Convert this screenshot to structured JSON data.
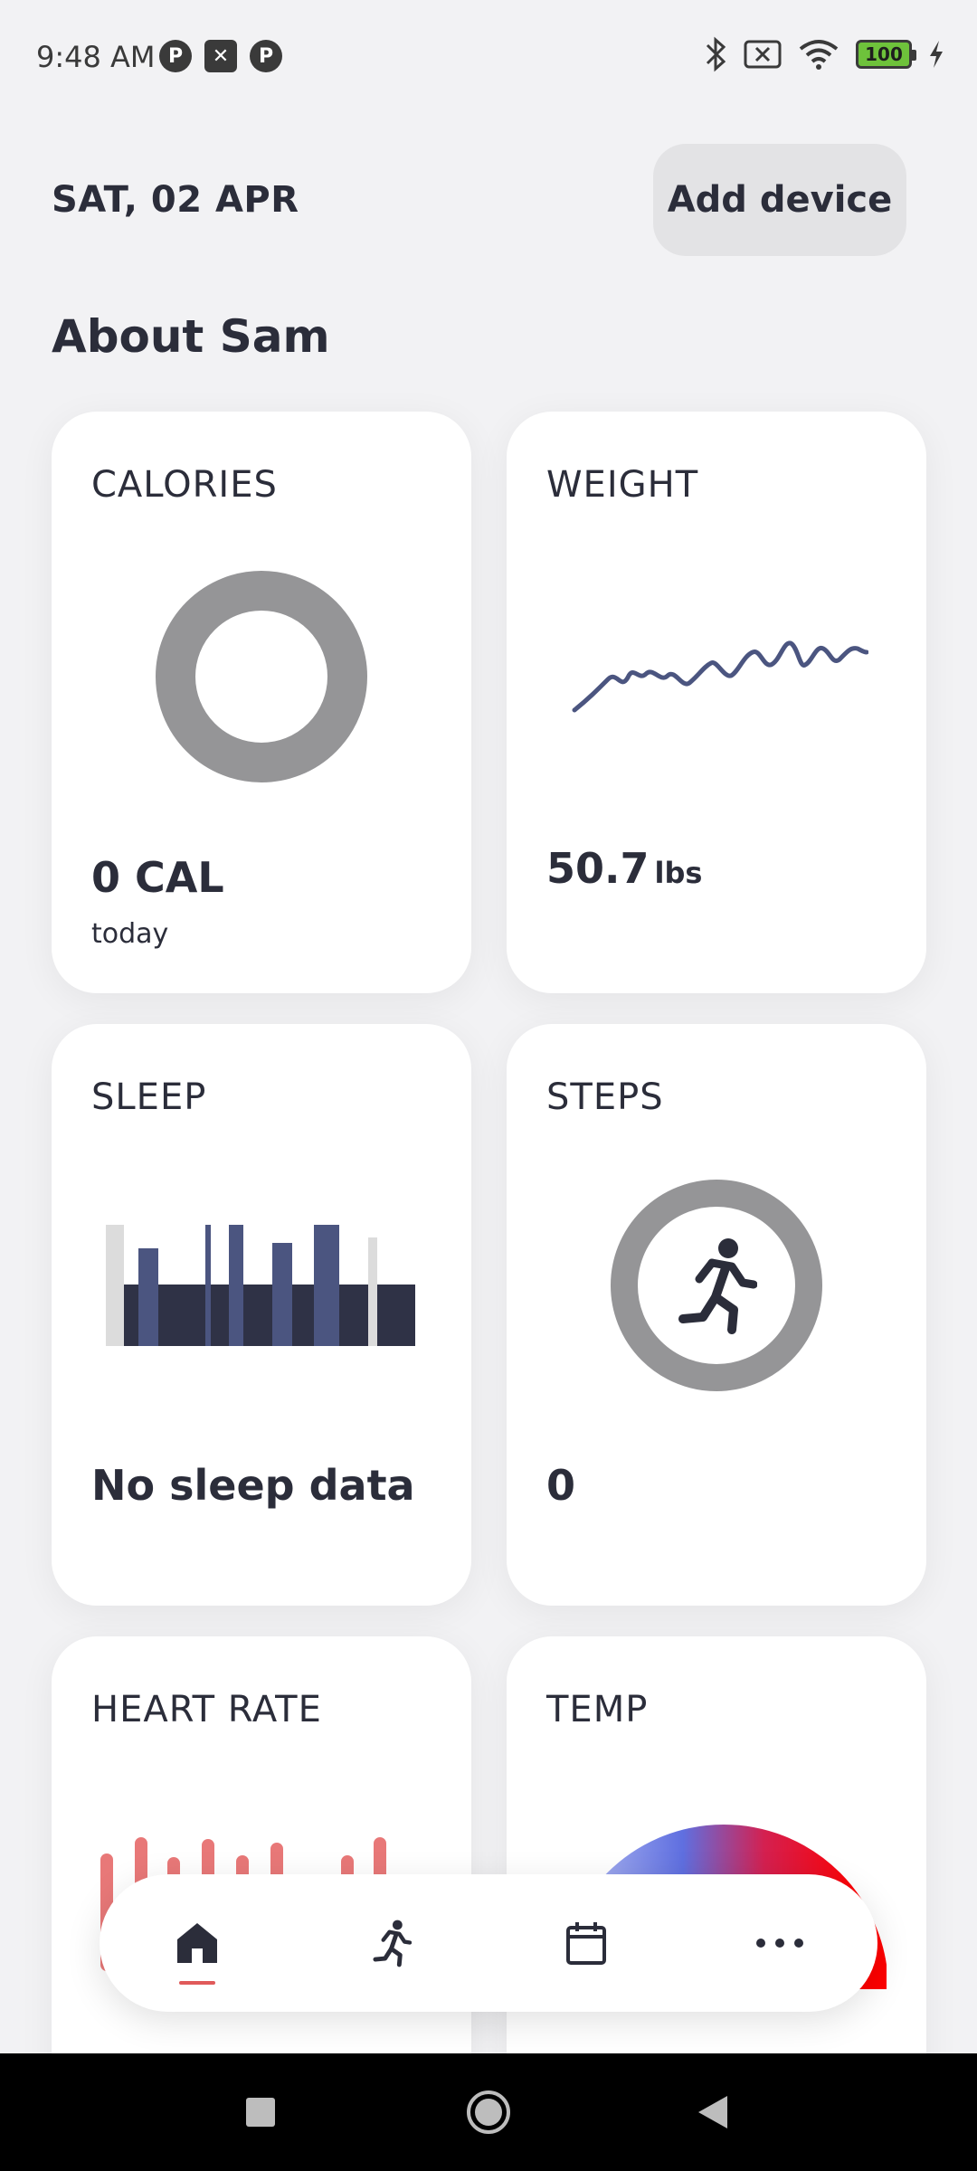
{
  "status_bar": {
    "time": "9:48 AM",
    "left_icons": [
      "app-notification-icon",
      "image-icon",
      "app-notification-icon"
    ],
    "battery_level": "100",
    "right_icons": [
      "bluetooth-icon",
      "sim-off-icon",
      "wifi-icon",
      "battery-icon",
      "charging-icon"
    ]
  },
  "header": {
    "date": "SAT, 02 APR",
    "add_device_label": "Add device",
    "section_title": "About Sam"
  },
  "cards": {
    "calories": {
      "title": "CALORIES",
      "value": "0 CAL",
      "sub": "today"
    },
    "weight": {
      "title": "WEIGHT",
      "value": "50.7",
      "unit": "lbs"
    },
    "sleep": {
      "title": "SLEEP",
      "value": "No sleep data"
    },
    "steps": {
      "title": "STEPS",
      "value": "0"
    },
    "heart_rate": {
      "title": "HEART RATE"
    },
    "temp": {
      "title": "TEMP"
    }
  },
  "bottom_nav": {
    "items": [
      "home-icon",
      "activity-icon",
      "calendar-icon",
      "more-icon"
    ],
    "active": "home-icon"
  },
  "colors": {
    "accent_red": "#e05a5a",
    "chart_navy": "#4b5580",
    "ring_gray": "#959597",
    "heart_bar": "#e87878"
  }
}
